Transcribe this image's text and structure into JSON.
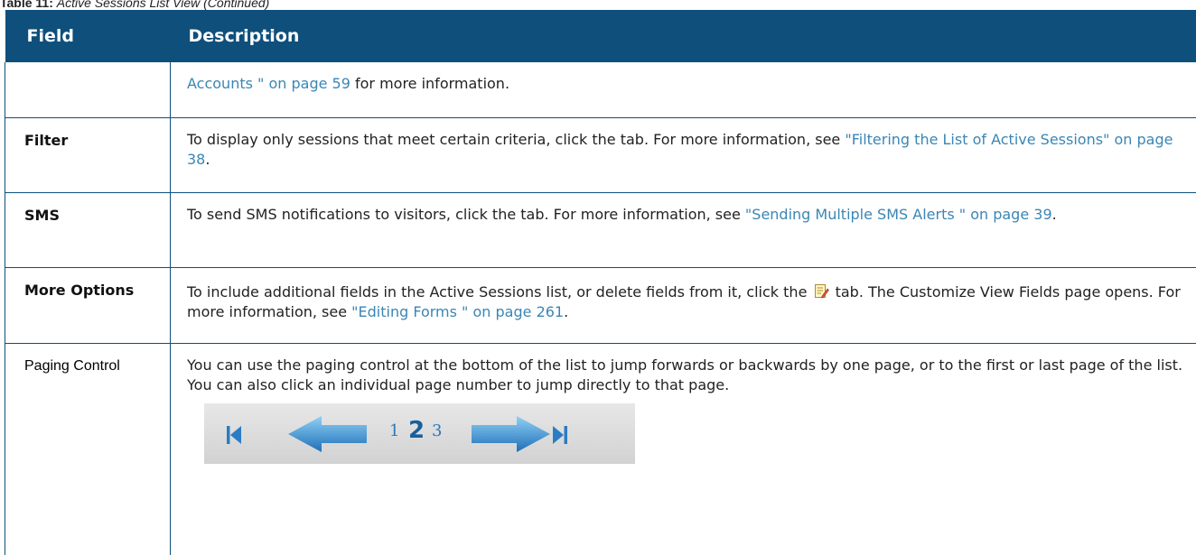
{
  "caption": {
    "label": "Table 11:",
    "text": "Active Sessions List View (Continued)"
  },
  "table": {
    "headers": {
      "field": "Field",
      "description": "Description"
    },
    "rows": [
      {
        "field": "",
        "desc_link": "Accounts \" on page 59",
        "desc_tail": " for more information."
      },
      {
        "field": "Filter",
        "desc_text": "To display only sessions that meet certain criteria, click the tab. For more information, see ",
        "desc_link": "\"Filtering the List of Active Sessions\" on page 38",
        "desc_tail": "."
      },
      {
        "field": "SMS",
        "desc_text": "To send SMS notifications to visitors, click the tab. For more information, see ",
        "desc_link": "\"Sending Multiple SMS Alerts \" on page 39",
        "desc_tail": "."
      },
      {
        "field": "More Options",
        "desc_text": "To include additional fields in the Active Sessions list, or delete fields from it, click the",
        "desc_text2": "tab. The Customize View Fields page opens. For more information, see ",
        "desc_link": "\"Editing Forms \" on page 261",
        "desc_tail": ".",
        "icon": "edit-form-icon"
      },
      {
        "field": "Paging Control",
        "desc_text": "You can use the paging control at the bottom of the list to jump forwards or backwards by one page, or to the first or last page of the list. You can also click an individual page number to jump directly to that page.",
        "pager": {
          "pages": [
            "1",
            "2",
            "3"
          ],
          "current": "2",
          "icons": [
            "first-page-icon",
            "previous-page-icon",
            "next-page-icon",
            "last-page-icon"
          ]
        }
      }
    ]
  },
  "colors": {
    "header_bg": "#0e4f7c",
    "link": "#3a86b4",
    "pager_arrow": "#2a7dc4"
  }
}
